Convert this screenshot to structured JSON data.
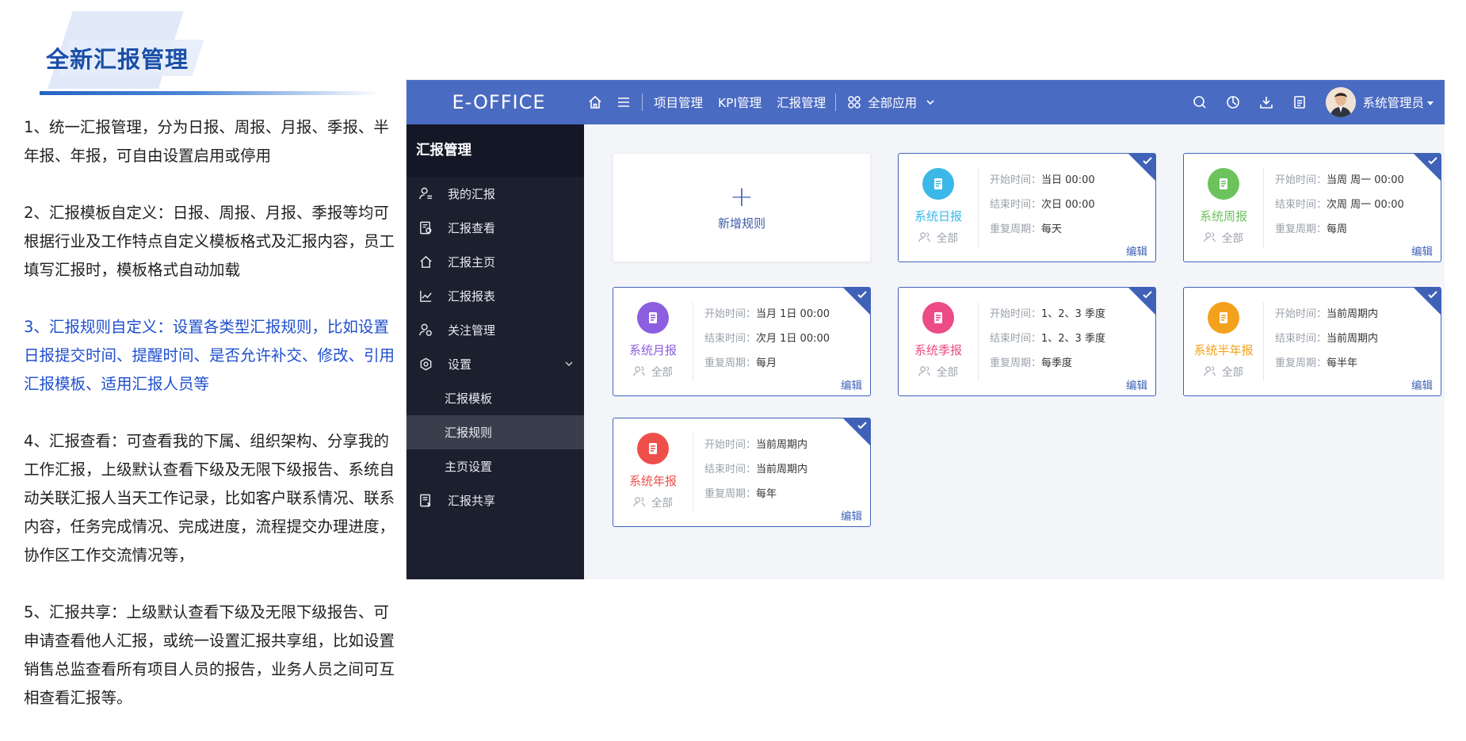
{
  "page": {
    "title": "全新汇报管理",
    "paragraphs": [
      {
        "text": "1、统一汇报管理，分为日报、周报、月报、季报、半年报、年报，可自由设置启用或停用",
        "highlight": false
      },
      {
        "text": "2、汇报模板自定义：日报、周报、月报、季报等均可根据行业及工作特点自定义模板格式及汇报内容，员工填写汇报时，模板格式自动加载",
        "highlight": false
      },
      {
        "text": "3、汇报规则自定义：设置各类型汇报规则，比如设置日报提交时间、提醒时间、是否允许补交、修改、引用汇报模板、适用汇报人员等",
        "highlight": true
      },
      {
        "text": "4、汇报查看：可查看我的下属、组织架构、分享我的工作汇报，上级默认查看下级及无限下级报告、系统自动关联汇报人当天工作记录，比如客户联系情况、联系内容，任务完成情况、完成进度，流程提交办理进度，协作区工作交流情况等，",
        "highlight": false
      },
      {
        "text": "5、汇报共享：上级默认查看下级及无限下级报告、可申请查看他人汇报，或统一设置汇报共享组，比如设置销售总监查看所有项目人员的报告，业务人员之间可互相查看汇报等。",
        "highlight": false
      }
    ]
  },
  "app": {
    "brand": "E-OFFICE",
    "nav": [
      "项目管理",
      "KPI管理",
      "汇报管理"
    ],
    "all_apps": "全部应用",
    "user": "系统管理员",
    "colors": {
      "topbar": "#4a6bc2",
      "sidebar": "#1b1f2e",
      "accent": "#3f62b8"
    }
  },
  "sidebar": {
    "header": "汇报管理",
    "items": [
      {
        "label": "我的汇报",
        "icon": "user-report-icon"
      },
      {
        "label": "汇报查看",
        "icon": "report-view-icon"
      },
      {
        "label": "汇报主页",
        "icon": "home-icon"
      },
      {
        "label": "汇报报表",
        "icon": "line-chart-icon"
      },
      {
        "label": "关注管理",
        "icon": "follow-users-icon"
      },
      {
        "label": "设置",
        "icon": "settings-icon"
      }
    ],
    "sub_items": [
      {
        "label": "汇报模板",
        "active": false
      },
      {
        "label": "汇报规则",
        "active": true
      },
      {
        "label": "主页设置",
        "active": false
      }
    ],
    "share": {
      "label": "汇报共享",
      "icon": "report-share-icon"
    }
  },
  "main": {
    "add_rule": "新增规则",
    "labels": {
      "start": "开始时间：",
      "end": "结束时间：",
      "repeat": "重复周期：",
      "scope": "全部",
      "edit": "编辑"
    },
    "cards": [
      {
        "name": "系统日报",
        "color": "#3bb8e8",
        "start": "当日 00:00",
        "end": "次日 00:00",
        "repeat": "每天"
      },
      {
        "name": "系统周报",
        "color": "#6cc35c",
        "start": "当周 周一 00:00",
        "end": "次周 周一 00:00",
        "repeat": "每周"
      },
      {
        "name": "系统月报",
        "color": "#8c5ee0",
        "start": "当月 1日 00:00",
        "end": "次月 1日 00:00",
        "repeat": "每月"
      },
      {
        "name": "系统季报",
        "color": "#ec4b86",
        "start": "1、2、3 季度",
        "end": "1、2、3 季度",
        "repeat": "每季度"
      },
      {
        "name": "系统半年报",
        "color": "#f4a11c",
        "start": "当前周期内",
        "end": "当前周期内",
        "repeat": "每半年"
      },
      {
        "name": "系统年报",
        "color": "#ef4f4a",
        "start": "当前周期内",
        "end": "当前周期内",
        "repeat": "每年"
      }
    ]
  }
}
